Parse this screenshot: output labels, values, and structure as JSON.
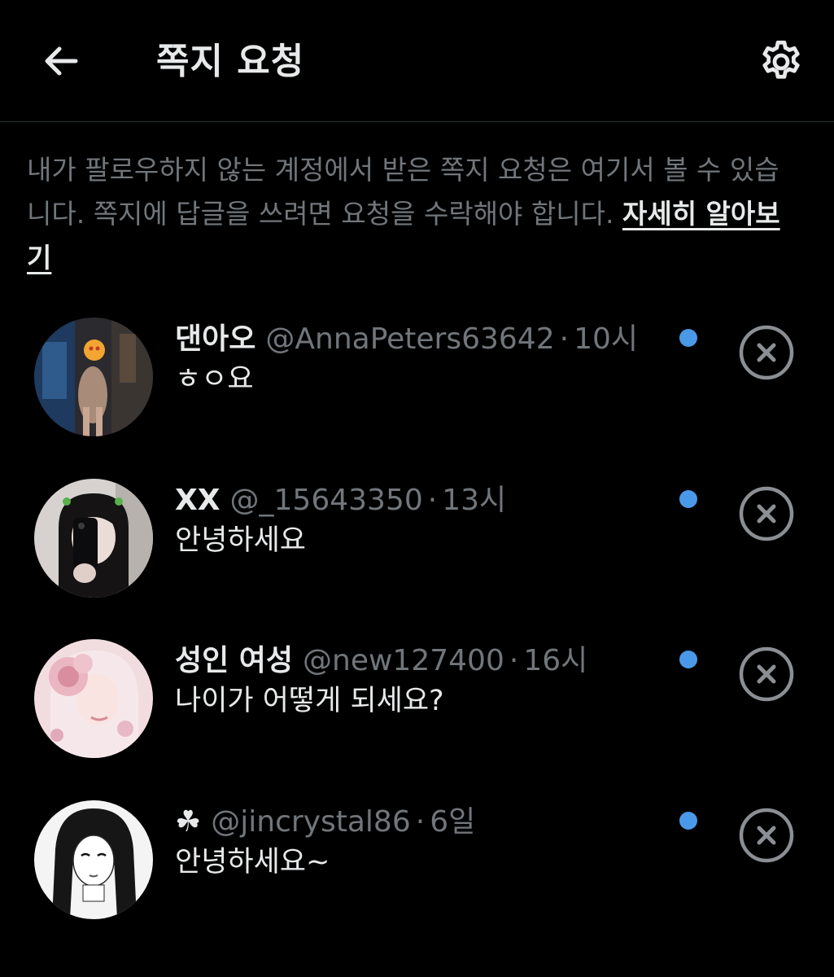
{
  "header": {
    "title": "쪽지 요청",
    "back_icon": "arrow-left-icon",
    "settings_icon": "gear-icon"
  },
  "info": {
    "text": "내가 팔로우하지 않는 계정에서 받은 쪽지 요청은 여기서 볼 수 있습니다. 쪽지에 답글을 쓰려면 요청을 수락해야 합니다. ",
    "learn_more": "자세히 알아보기"
  },
  "colors": {
    "background": "#000000",
    "text_primary": "#e7e9ea",
    "text_secondary": "#71767b",
    "unread_dot": "#4a99e9",
    "dismiss_icon": "#8b8f93"
  },
  "requests": [
    {
      "name": "댄아오",
      "handle": "@AnnaPeters63642",
      "separator": "·",
      "time": "10시",
      "message": "ㅎㅇ요",
      "unread": true
    },
    {
      "name": "XX",
      "handle": "@_15643350",
      "separator": "·",
      "time": "13시",
      "message": "안녕하세요",
      "unread": true
    },
    {
      "name": "성인 여성",
      "handle": "@new127400",
      "separator": "·",
      "time": "16시",
      "message": "나이가 어떻게 되세요?",
      "unread": true
    },
    {
      "name": "☘",
      "handle": "@jincrystal86",
      "separator": "·",
      "time": "6일",
      "message": "안녕하세요~",
      "unread": true
    }
  ]
}
